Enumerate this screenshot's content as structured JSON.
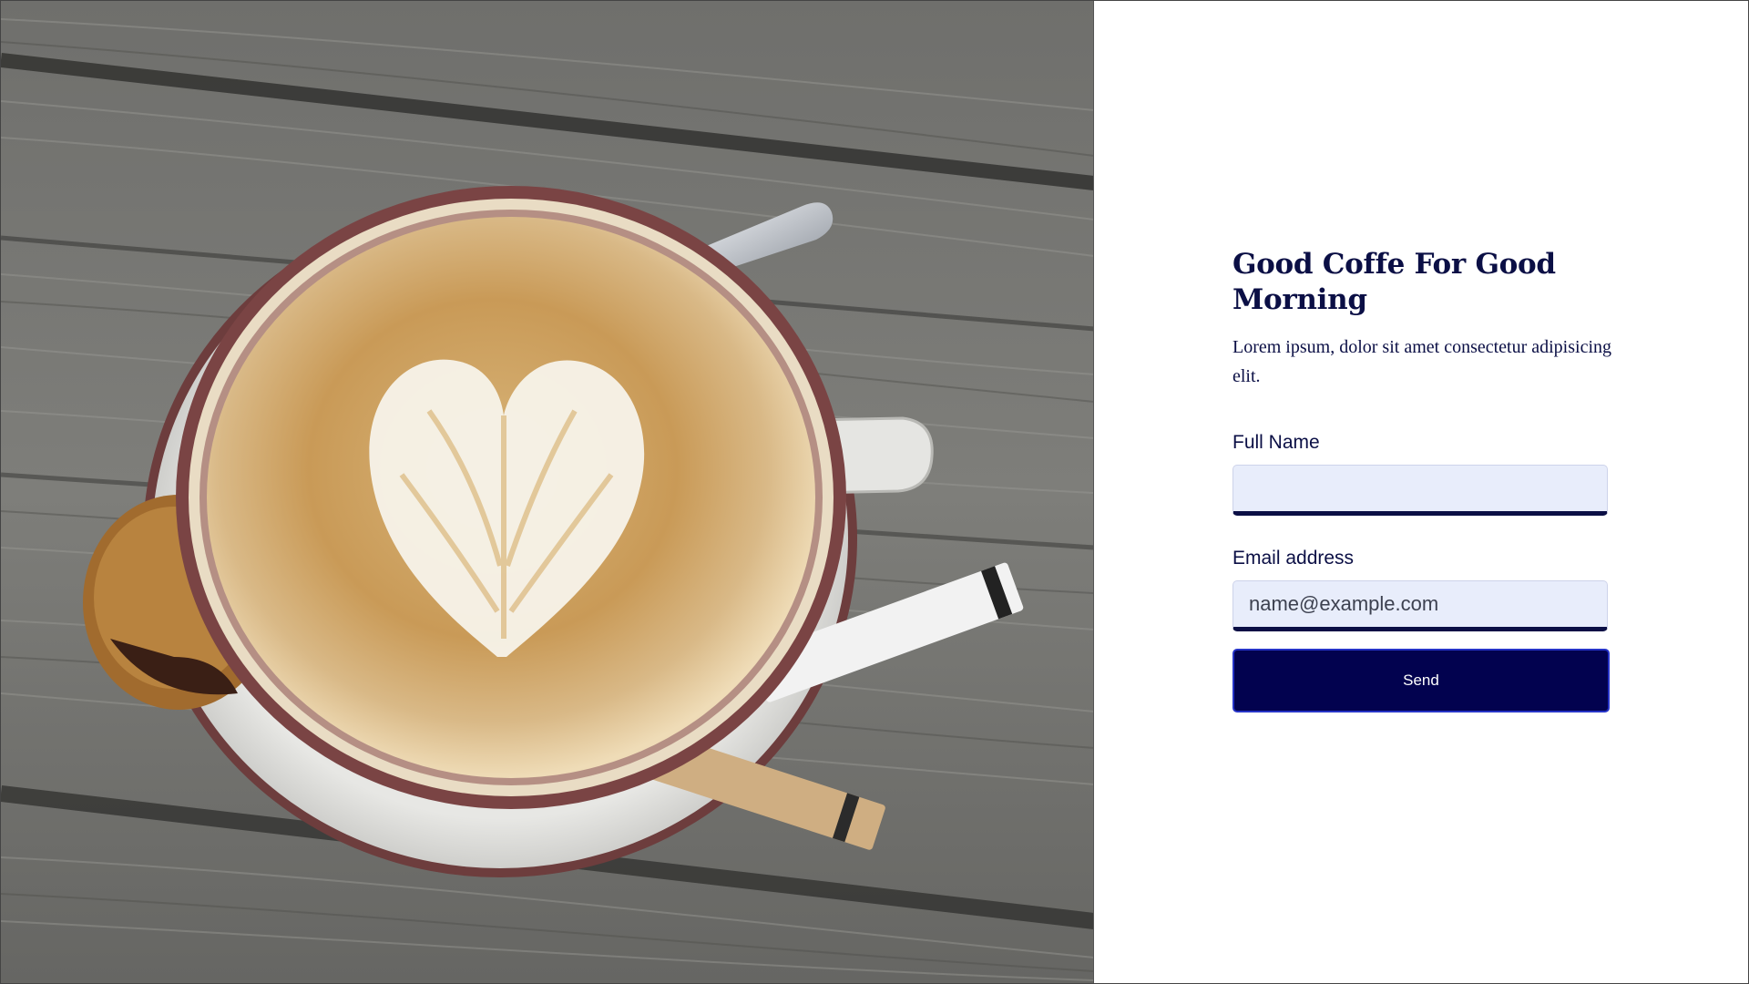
{
  "hero": {
    "image_alt": "coffee-latte-photo"
  },
  "form": {
    "title": "Good Coffe For Good Morning",
    "lead": "Lorem ipsum, dolor sit amet consectetur adipisicing elit.",
    "full_name": {
      "label": "Full Name",
      "value": "",
      "placeholder": ""
    },
    "email": {
      "label": "Email address",
      "value": "",
      "placeholder": "name@example.com"
    },
    "send_label": "Send"
  },
  "colors": {
    "primary": "#02024f",
    "heading": "#0b0f45",
    "input_bg": "#e8edfb"
  }
}
